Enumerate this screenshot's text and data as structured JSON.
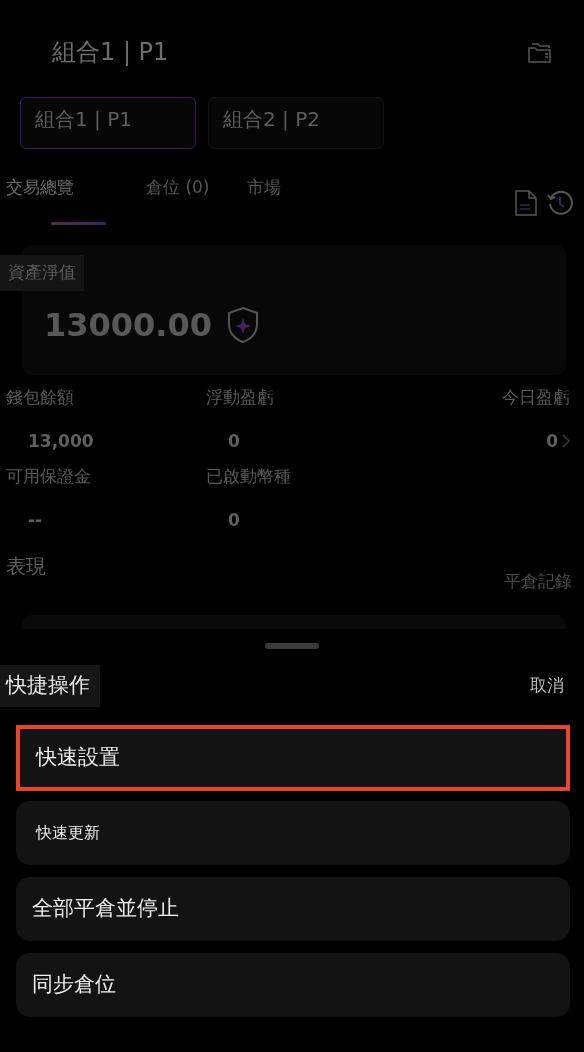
{
  "header": {
    "title": "組合1 | P1"
  },
  "portfolio_tabs": [
    {
      "label": "組合1 | P1",
      "selected": true
    },
    {
      "label": "組合2 | P2",
      "selected": false
    }
  ],
  "section_tabs": [
    {
      "label": "交易總覽",
      "selected": true
    },
    {
      "label": "倉位 (0)",
      "selected": false
    },
    {
      "label": "市場",
      "selected": false
    }
  ],
  "equity": {
    "label": "資產淨值",
    "value": "13000.00"
  },
  "stats": [
    {
      "label": "錢包餘額",
      "value": "13,000"
    },
    {
      "label": "浮動盈虧",
      "value": "0"
    },
    {
      "label": "今日盈虧",
      "value": "0",
      "link": true
    },
    {
      "label": "可用保證金",
      "value": "--"
    },
    {
      "label": "已啟動幣種",
      "value": "0"
    }
  ],
  "performance": {
    "title": "表現",
    "link": "平倉記錄"
  },
  "sheet": {
    "title": "快捷操作",
    "cancel": "取消",
    "actions": [
      {
        "label": "快速設置",
        "selected": true
      },
      {
        "label": "快速更新",
        "selected": false
      },
      {
        "label": "全部平倉並停止",
        "selected": false
      },
      {
        "label": "同步倉位",
        "selected": false
      }
    ]
  }
}
